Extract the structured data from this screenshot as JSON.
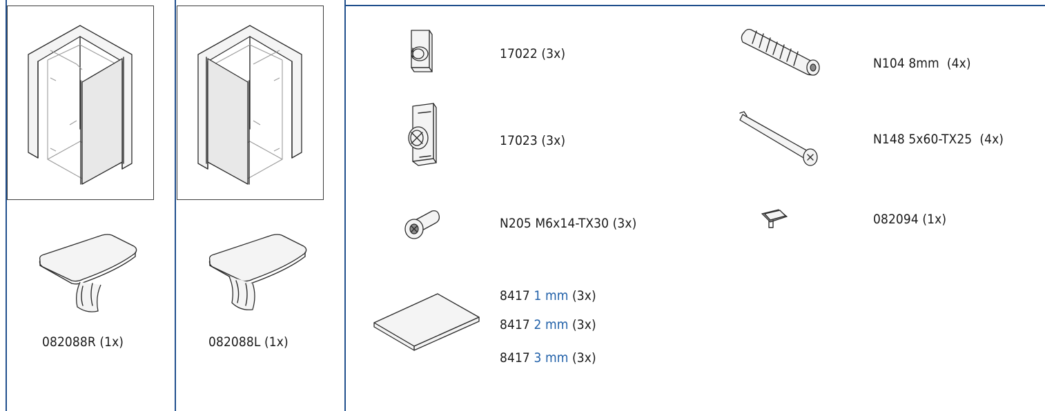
{
  "shower_models": [
    {
      "label": "082088R (1x)",
      "side": "right"
    },
    {
      "label": "082088L (1x)",
      "side": "left"
    }
  ],
  "parts_left": [
    {
      "label": "17022 (3x)",
      "icon": "mounting-plate-icon"
    },
    {
      "label": "17023 (3x)",
      "icon": "clip-bracket-icon"
    },
    {
      "label": "N205 M6x14-TX30 (3x)",
      "icon": "bolt-icon"
    }
  ],
  "parts_right": [
    {
      "label": "N104 8mm  (4x)",
      "icon": "wall-plug-icon"
    },
    {
      "label": "N148 5x60-TX25  (4x)",
      "icon": "screw-icon"
    },
    {
      "label": "082094 (1x)",
      "icon": "end-cap-icon"
    }
  ],
  "shims": {
    "icon": "shim-plate-icon",
    "rows": [
      {
        "code": "8417",
        "size": "1 mm",
        "qty": "(3x)"
      },
      {
        "code": "8417",
        "size": "2 mm",
        "qty": "(3x)"
      },
      {
        "code": "8417",
        "size": "3 mm",
        "qty": "(3x)"
      }
    ]
  },
  "colors": {
    "frame": "#1f4e8c",
    "size_highlight": "#1f5fa8"
  }
}
